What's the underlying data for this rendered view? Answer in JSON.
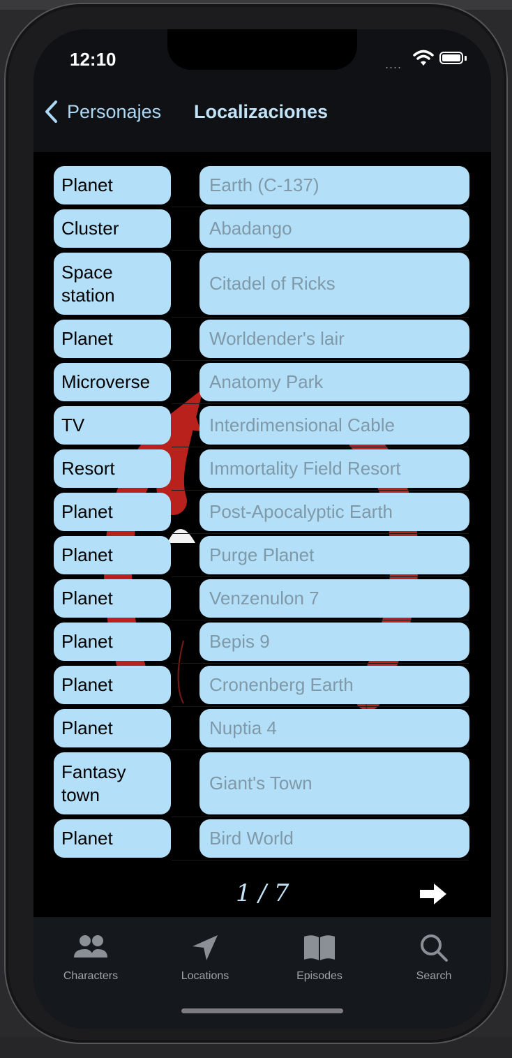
{
  "status": {
    "time": "12:10",
    "signal": "....",
    "icons": [
      "wifi-icon",
      "battery-icon"
    ]
  },
  "nav": {
    "back_label": "Personajes",
    "title": "Localizaciones"
  },
  "locations": [
    {
      "type": "Planet",
      "name": "Earth (C-137)"
    },
    {
      "type": "Cluster",
      "name": "Abadango"
    },
    {
      "type": "Space station",
      "name": "Citadel of Ricks"
    },
    {
      "type": "Planet",
      "name": "Worldender's lair"
    },
    {
      "type": "Microverse",
      "name": "Anatomy Park"
    },
    {
      "type": "TV",
      "name": "Interdimensional Cable"
    },
    {
      "type": "Resort",
      "name": "Immortality Field Resort"
    },
    {
      "type": "Planet",
      "name": "Post-Apocalyptic Earth"
    },
    {
      "type": "Planet",
      "name": "Purge Planet"
    },
    {
      "type": "Planet",
      "name": "Venzenulon 7"
    },
    {
      "type": "Planet",
      "name": "Bepis 9"
    },
    {
      "type": "Planet",
      "name": "Cronenberg Earth"
    },
    {
      "type": "Planet",
      "name": "Nuptia 4"
    },
    {
      "type": "Fantasy town",
      "name": "Giant's Town"
    },
    {
      "type": "Planet",
      "name": "Bird World"
    }
  ],
  "pager": {
    "indicator": "1 / 7",
    "next_icon": "arrow-right-icon"
  },
  "tabs": [
    {
      "label": "Characters",
      "icon": "people-icon"
    },
    {
      "label": "Locations",
      "icon": "location-arrow-icon"
    },
    {
      "label": "Episodes",
      "icon": "book-icon"
    },
    {
      "label": "Search",
      "icon": "magnifier-icon"
    }
  ],
  "colors": {
    "chip": "#b3e0f8",
    "accent": "#add8f5",
    "background": "#000000",
    "tab_bar": "#15181c"
  }
}
